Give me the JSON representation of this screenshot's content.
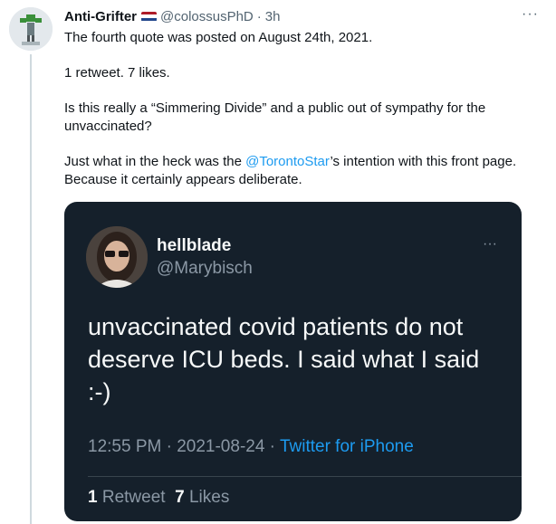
{
  "tweet": {
    "author_name": "Anti-Grifter",
    "author_handle": "@colossusPhD",
    "separator": "·",
    "time": "3h",
    "more_label": "···",
    "paragraphs": {
      "p1": "The fourth quote was posted on August 24th, 2021.",
      "p2": "1 retweet. 7 likes.",
      "p3": "Is this really a “Simmering Divide” and a public out of sympathy for the unvaccinated?",
      "p4_before": "Just what in the heck was the ",
      "p4_mention": "@TorontoStar",
      "p4_after": "’s intention with this front page. Because it certainly appears deliberate."
    },
    "flag_icon": "netherlands-flag-icon"
  },
  "quoted": {
    "author_name": "hellblade",
    "author_handle": "@Marybisch",
    "more_label": "···",
    "text": "unvaccinated covid patients do not deserve ICU beds. I said what I said :-)",
    "meta_time": "12:55 PM · 2021-08-24 · ",
    "meta_source": "Twitter for iPhone",
    "retweet_count": "1",
    "retweet_label": "Retweet",
    "like_count": "7",
    "like_label": "Likes"
  },
  "colors": {
    "accent": "#1d9bf0",
    "card_bg": "#15202b",
    "muted": "#536471"
  }
}
